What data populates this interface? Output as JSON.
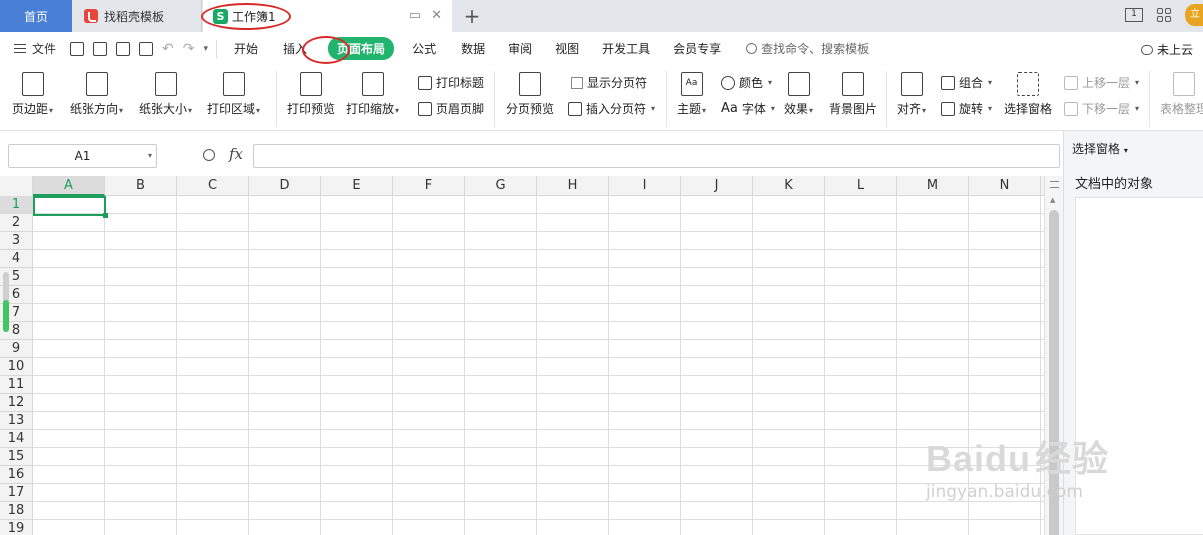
{
  "tabs": {
    "home": "首页",
    "find_template": "找稻壳模板",
    "workbook": "工作簿1",
    "workbook_icon_letter": "S"
  },
  "window": {
    "layout_label": "1",
    "avatar_text": "立"
  },
  "menu": {
    "file": "文件",
    "tabs": [
      "开始",
      "插入",
      "页面布局",
      "公式",
      "数据",
      "审阅",
      "视图",
      "开发工具",
      "会员专享"
    ],
    "active_tab": "页面布局",
    "search_placeholder": "查找命令、搜索模板",
    "cloud": "未上云"
  },
  "ribbon": {
    "margins": "页边距",
    "orientation": "纸张方向",
    "paper_size": "纸张大小",
    "print_area": "打印区域",
    "print_preview": "打印预览",
    "print_scale": "打印缩放",
    "print_titles": "打印标题",
    "header_footer": "页眉页脚",
    "page_break_preview": "分页预览",
    "show_page_breaks": "显示分页符",
    "insert_page_break": "插入分页符",
    "theme": "主题",
    "colors": "颜色",
    "fonts": "字体",
    "fonts_prefix": "Aa",
    "theme_icon": "Aa",
    "effects": "效果",
    "background_image": "背景图片",
    "align": "对齐",
    "group": "组合",
    "rotate": "旋转",
    "selection_pane": "选择窗格",
    "bring_forward": "上移一层",
    "send_backward": "下移一层",
    "table_tidy": "表格整理"
  },
  "formula_bar": {
    "name_box": "A1",
    "fx": "fx",
    "formula": ""
  },
  "sheet": {
    "columns": [
      "A",
      "B",
      "C",
      "D",
      "E",
      "F",
      "G",
      "H",
      "I",
      "J",
      "K",
      "L",
      "M",
      "N"
    ],
    "rows": [
      "1",
      "2",
      "3",
      "4",
      "5",
      "6",
      "7",
      "8",
      "9",
      "10",
      "11",
      "12",
      "13",
      "14",
      "15",
      "16",
      "17",
      "18",
      "19"
    ],
    "active_cell": "A1"
  },
  "pane": {
    "title": "选择窗格",
    "subtitle": "文档中的对象"
  },
  "watermark": {
    "brand": "Bai",
    "brand_cn": "经验",
    "url": "jingyan.baidu.com"
  },
  "colors": {
    "accent_green": "#21b46e",
    "home_tab_blue": "#4a7fd6",
    "annotation_red": "#d62a2a"
  }
}
